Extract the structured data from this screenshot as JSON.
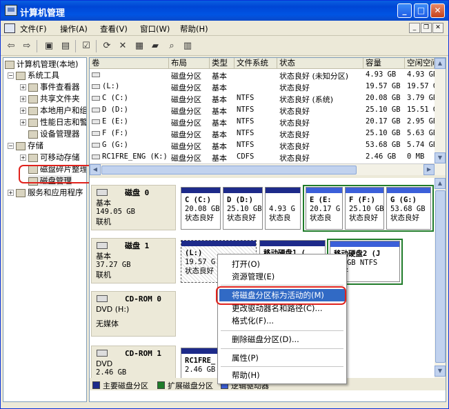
{
  "window": {
    "title": "计算机管理"
  },
  "menu": [
    "文件(F)",
    "操作(A)",
    "查看(V)",
    "窗口(W)",
    "帮助(H)"
  ],
  "tree": {
    "root": "计算机管理(本地)",
    "system_tools": "系统工具",
    "event_viewer": "事件查看器",
    "shared_folders": "共享文件夹",
    "local_users": "本地用户和组",
    "perf_logs": "性能日志和警报",
    "device_manager": "设备管理器",
    "storage": "存储",
    "removable_storage": "可移动存储",
    "defrag": "磁盘碎片整理程序",
    "disk_management": "磁盘管理",
    "services": "服务和应用程序"
  },
  "list": {
    "headers": [
      "卷",
      "布局",
      "类型",
      "文件系统",
      "状态",
      "容量",
      "空闲空间"
    ],
    "rows": [
      {
        "vol": "",
        "layout": "磁盘分区",
        "type": "基本",
        "fs": "",
        "status": "状态良好 (未知分区)",
        "cap": "4.93 GB",
        "free": "4.93 GB"
      },
      {
        "vol": "(L:)",
        "layout": "磁盘分区",
        "type": "基本",
        "fs": "",
        "status": "状态良好",
        "cap": "19.57 GB",
        "free": "19.57 GB"
      },
      {
        "vol": "C (C:)",
        "layout": "磁盘分区",
        "type": "基本",
        "fs": "NTFS",
        "status": "状态良好 (系统)",
        "cap": "20.08 GB",
        "free": "3.79 GB"
      },
      {
        "vol": "D (D:)",
        "layout": "磁盘分区",
        "type": "基本",
        "fs": "NTFS",
        "status": "状态良好",
        "cap": "25.10 GB",
        "free": "15.51 GB"
      },
      {
        "vol": "E (E:)",
        "layout": "磁盘分区",
        "type": "基本",
        "fs": "NTFS",
        "status": "状态良好",
        "cap": "20.17 GB",
        "free": "2.95 GB"
      },
      {
        "vol": "F (F:)",
        "layout": "磁盘分区",
        "type": "基本",
        "fs": "NTFS",
        "status": "状态良好",
        "cap": "25.10 GB",
        "free": "5.63 GB"
      },
      {
        "vol": "G (G:)",
        "layout": "磁盘分区",
        "type": "基本",
        "fs": "NTFS",
        "status": "状态良好",
        "cap": "53.68 GB",
        "free": "5.74 GB"
      },
      {
        "vol": "RC1FRE_ENG (K:)",
        "layout": "磁盘分区",
        "type": "基本",
        "fs": "CDFS",
        "status": "状态良好",
        "cap": "2.46 GB",
        "free": "0 MB"
      }
    ]
  },
  "disks": {
    "disk0": {
      "name": "磁盘 0",
      "type": "基本",
      "size": "149.05 GB",
      "status": "联机",
      "parts": [
        {
          "l1": "C  (C:)",
          "l2": "20.08 GB",
          "l3": "状态良好"
        },
        {
          "l1": "D  (D:)",
          "l2": "25.10 GB",
          "l3": "状态良好"
        },
        {
          "l1": "",
          "l2": "4.93 G",
          "l3": "状态良"
        },
        {
          "l1": "E  (E:",
          "l2": "20.17 G",
          "l3": "状态良"
        },
        {
          "l1": "F  (F:)",
          "l2": "25.10 GB",
          "l3": "状态良好"
        },
        {
          "l1": "G  (G:)",
          "l2": "53.68 GB",
          "l3": "状态良好"
        }
      ]
    },
    "disk1": {
      "name": "磁盘 1",
      "type": "基本",
      "size": "37.27 GB",
      "status": "联机",
      "parts": [
        {
          "l1": "(L:)",
          "l2": "19.57 G",
          "l3": "状态良好"
        },
        {
          "l1": "移动硬盘1 (",
          "l2": "",
          "l3": ""
        },
        {
          "l1": "移动硬盘2  (J",
          "l2": "79 GB NTFS",
          "l3": "良好"
        }
      ]
    },
    "cdrom0": {
      "name": "CD-ROM 0",
      "type": "DVD (H:)",
      "status": "无媒体"
    },
    "cdrom1": {
      "name": "CD-ROM 1",
      "type": "DVD",
      "size": "2.46 GB",
      "parts": [
        {
          "l1": "RC1FRE_",
          "l2": "2.46 GB",
          "l3": ""
        }
      ]
    }
  },
  "legend": [
    "主要磁盘分区",
    "扩展磁盘分区",
    "逻辑驱动器"
  ],
  "context_menu": {
    "open": "打开(O)",
    "explore": "资源管理(E)",
    "mark_active": "将磁盘分区标为活动的(M)",
    "change_letter": "更改驱动器名和路径(C)...",
    "format": "格式化(F)...",
    "delete": "删除磁盘分区(D)...",
    "properties": "属性(P)",
    "help": "帮助(H)"
  },
  "colors": {
    "primary": "#1d2a8a",
    "extended": "#1f7b29",
    "logical": "#3b5fd9",
    "highlight": "#e0221c"
  }
}
